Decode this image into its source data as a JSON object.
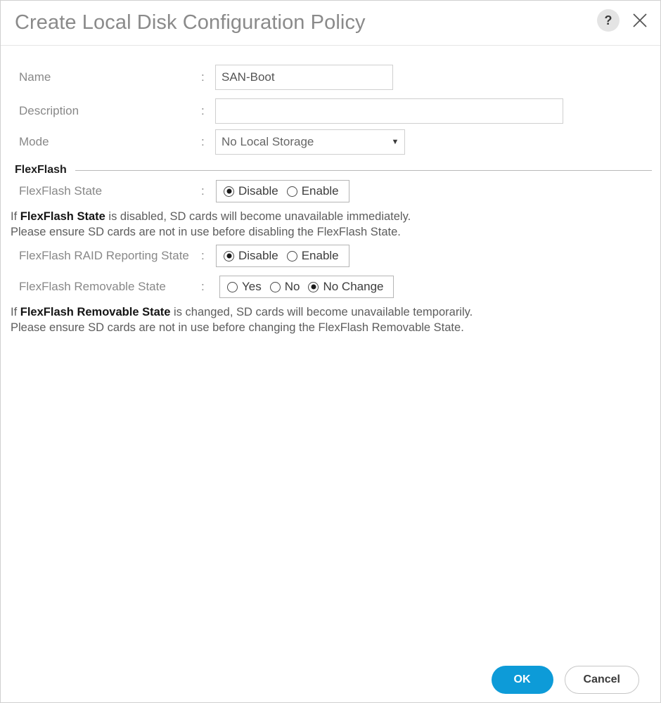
{
  "window": {
    "title": "Create Local Disk Configuration Policy",
    "help_icon_label": "?",
    "help_icon_name": "help-icon",
    "close_icon_name": "close-icon"
  },
  "colors": {
    "primary_button": "#0d9bd8",
    "title_text": "#8a8a8a",
    "label_text": "#888888",
    "help_text": "#5d5d5d",
    "border": "#cfcfcf"
  },
  "form": {
    "name": {
      "label": "Name",
      "separator": ":",
      "value": "SAN-Boot",
      "placeholder": ""
    },
    "description": {
      "label": "Description",
      "separator": ":",
      "value": "",
      "placeholder": ""
    },
    "mode": {
      "label": "Mode",
      "separator": ":",
      "value": "No Local Storage",
      "arrow": "▼",
      "options": [
        "No Local Storage"
      ]
    }
  },
  "flexflash": {
    "section_title": "FlexFlash",
    "state": {
      "label": "FlexFlash State",
      "separator": ":",
      "options": [
        {
          "label": "Disable",
          "checked": true
        },
        {
          "label": "Enable",
          "checked": false
        }
      ]
    },
    "state_help": {
      "line1_prefix": "If ",
      "line1_bold": "FlexFlash State",
      "line1_suffix": " is disabled, SD cards will become unavailable immediately.",
      "line2": "Please ensure SD cards are not in use before disabling the FlexFlash State."
    },
    "raid_reporting": {
      "label": "FlexFlash RAID Reporting State",
      "separator": ":",
      "options": [
        {
          "label": "Disable",
          "checked": true
        },
        {
          "label": "Enable",
          "checked": false
        }
      ]
    },
    "removable": {
      "label": "FlexFlash Removable State",
      "separator": ":",
      "options": [
        {
          "label": "Yes",
          "checked": false
        },
        {
          "label": "No",
          "checked": false
        },
        {
          "label": "No Change",
          "checked": true
        }
      ]
    },
    "removable_help": {
      "line1_prefix": "If ",
      "line1_bold": "FlexFlash Removable State",
      "line1_suffix": " is changed, SD cards will become unavailable temporarily.",
      "line2": "Please ensure SD cards are not in use before changing the FlexFlash Removable State."
    }
  },
  "footer": {
    "ok_label": "OK",
    "cancel_label": "Cancel"
  }
}
